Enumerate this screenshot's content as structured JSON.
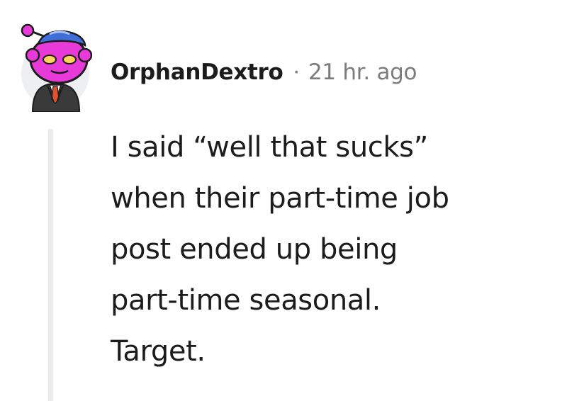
{
  "comment": {
    "author": "OrphanDextro",
    "separator": "·",
    "timestamp": "21 hr. ago",
    "body_lines": [
      "I said “well that sucks”",
      "when their part-time job",
      "post ended up being",
      "part-time seasonal.",
      "Target."
    ]
  },
  "colors": {
    "avatar_pink": "#e83ad8",
    "avatar_hat": "#3f6ed8",
    "avatar_bg": "#eeeff1",
    "suit": "#3a3a3a",
    "tie": "#e0522d",
    "username": "#1c1c1c",
    "meta": "#7c7c7c",
    "thread_line": "#ececec"
  },
  "icons": {
    "avatar": "snoo-avatar-icon"
  }
}
